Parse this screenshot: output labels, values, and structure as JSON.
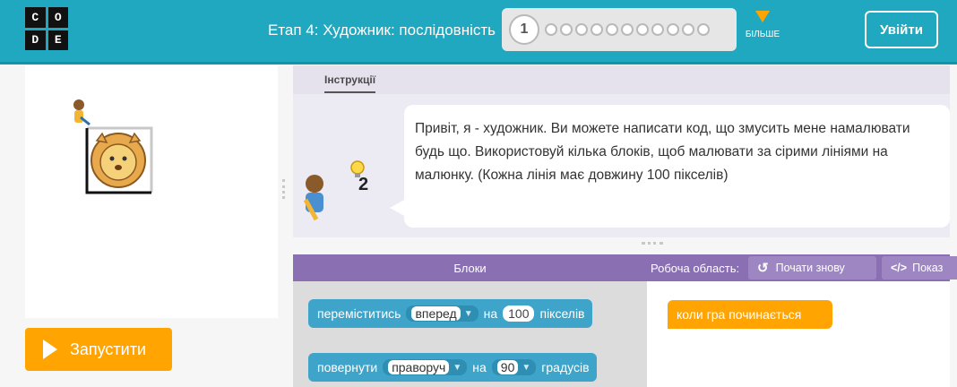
{
  "header": {
    "logo_letters": [
      "C",
      "O",
      "D",
      "E"
    ],
    "stage_title": "Етап 4: Художник: послідовність",
    "progress": {
      "current": "1",
      "remaining_count": 11
    },
    "more_label": "БІЛЬШЕ",
    "signin_label": "Увійти"
  },
  "run_button": {
    "label": "Запустити"
  },
  "instructions": {
    "tab_label": "Інструкції",
    "text": "Привіт, я - художник. Ви можете написати код, що змусить мене намалювати будь що. Використовуй кілька блоків, щоб малювати за сірими лініями на малюнку. (Кожна лінія має довжину 100 пікселів)",
    "hint_count": "2"
  },
  "blocks_panel": {
    "title": "Блоки"
  },
  "workspace_panel": {
    "title": "Робоча область:",
    "restart_label": "Почати знову",
    "show_code_label": "Показ"
  },
  "blocks": {
    "move": {
      "verb": "переміститись",
      "direction": "вперед",
      "on": "на",
      "amount": "100",
      "unit": "пікселів"
    },
    "turn": {
      "verb": "повернути",
      "direction": "праворуч",
      "on": "на",
      "amount": "90",
      "unit": "градусів"
    }
  },
  "event_block": {
    "label": "коли гра починається"
  },
  "colors": {
    "header": "#1fa8bf",
    "accent_orange": "#ffa400",
    "block_blue": "#3fa4c9",
    "panel_purple": "#8a6fb3"
  }
}
